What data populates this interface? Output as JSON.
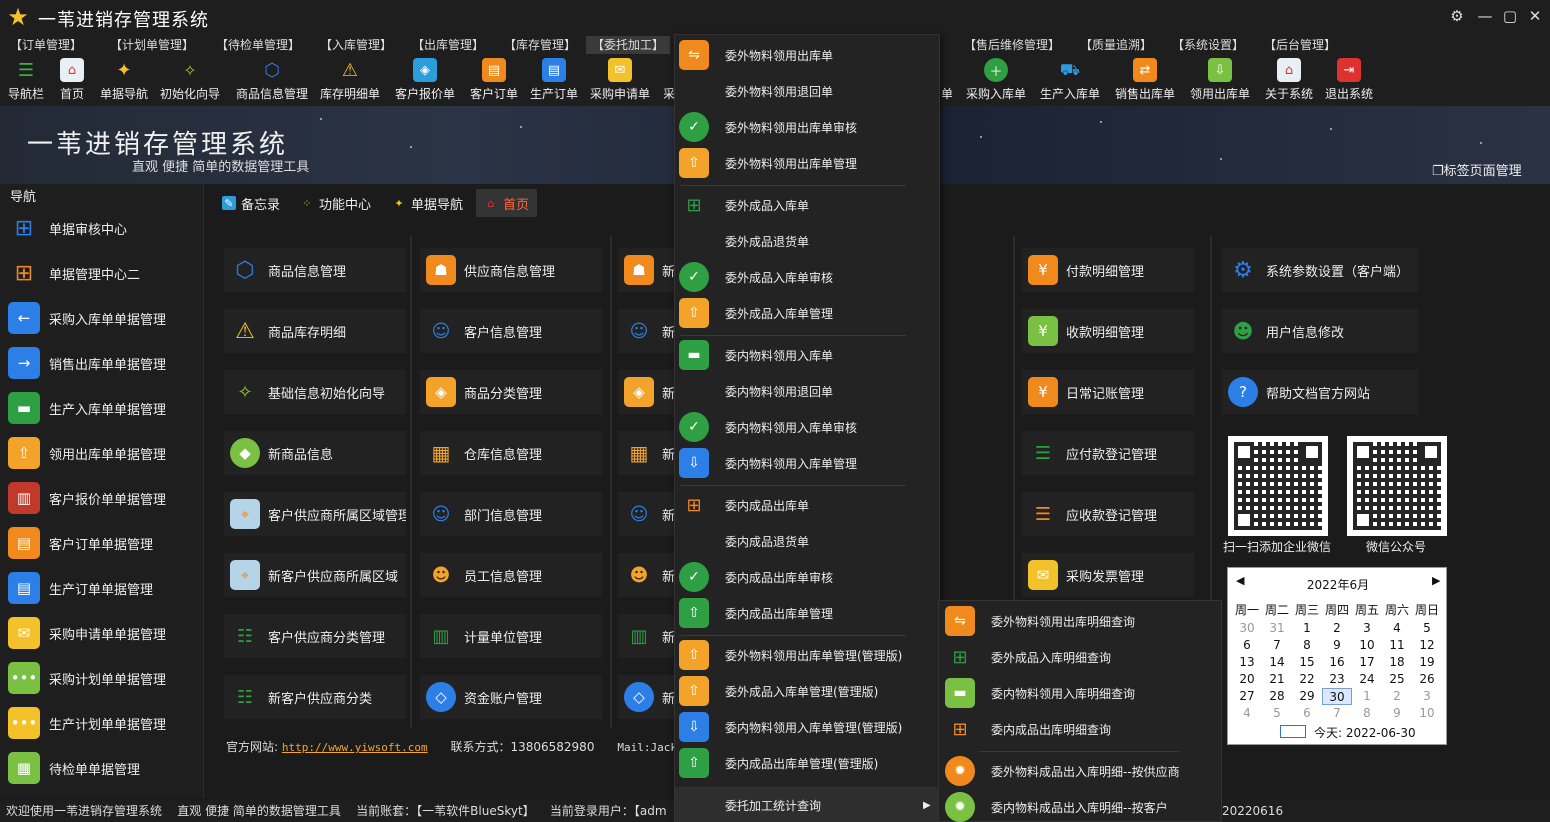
{
  "app": {
    "title": "一苇进销存管理系统"
  },
  "menus": [
    "【订单管理】",
    "【计划单管理】",
    "【待检单管理】",
    "【入库管理】",
    "【出库管理】",
    "【库存管理】",
    "【委托加工】",
    "【售后维修管理】",
    "【质量追溯】",
    "【系统设置】",
    "【后台管理】"
  ],
  "toolbar": [
    "导航栏",
    "首页",
    "单据导航",
    "初始化向导",
    "商品信息管理",
    "库存明细单",
    "客户报价单",
    "客户订单",
    "生产订单",
    "采购申请单",
    "采",
    "单",
    "采购入库单",
    "生产入库单",
    "销售出库单",
    "领用出库单",
    "关于系统",
    "退出系统"
  ],
  "banner": {
    "title": "一苇进销存管理系统",
    "subtitle": "直观 便捷 简单的数据管理工具",
    "tab_manage": "标签页面管理"
  },
  "sidebar": {
    "label": "导航",
    "items": [
      "单据审核中心",
      "单据管理中心二",
      "采购入库单单据管理",
      "销售出库单单据管理",
      "生产入库单单据管理",
      "领用出库单单据管理",
      "客户报价单单据管理",
      "客户订单单据管理",
      "生产订单单据管理",
      "采购申请单单据管理",
      "采购计划单单据管理",
      "生产计划单单据管理",
      "待检单单据管理"
    ]
  },
  "tabs": [
    "备忘录",
    "功能中心",
    "单据导航",
    "首页"
  ],
  "cards": {
    "col1": [
      "商品信息管理",
      "商品库存明细",
      "基础信息初始化向导",
      "新商品信息",
      "客户供应商所属区域管理",
      "新客户供应商所属区域",
      "客户供应商分类管理",
      "新客户供应商分类"
    ],
    "col2": [
      "供应商信息管理",
      "客户信息管理",
      "商品分类管理",
      "仓库信息管理",
      "部门信息管理",
      "员工信息管理",
      "计量单位管理",
      "资金账户管理"
    ],
    "col3": [
      "新",
      "新",
      "新",
      "新",
      "新",
      "新",
      "新",
      "新"
    ],
    "col4": [
      "付款明细管理",
      "收款明细管理",
      "日常记账管理",
      "应付款登记管理",
      "应收款登记管理",
      "采购发票管理"
    ],
    "col5": [
      "系统参数设置（客户端）",
      "用户信息修改",
      "帮助文档官方网站"
    ]
  },
  "qr": {
    "left_caption": "扫一扫添加企业微信",
    "right_caption": "微信公众号"
  },
  "calendar": {
    "month": "2022年6月",
    "weekdays": [
      "周一",
      "周二",
      "周三",
      "周四",
      "周五",
      "周六",
      "周日"
    ],
    "rows": [
      [
        "30",
        "31",
        "1",
        "2",
        "3",
        "4",
        "5"
      ],
      [
        "6",
        "7",
        "8",
        "9",
        "10",
        "11",
        "12"
      ],
      [
        "13",
        "14",
        "15",
        "16",
        "17",
        "18",
        "19"
      ],
      [
        "20",
        "21",
        "22",
        "23",
        "24",
        "25",
        "26"
      ],
      [
        "27",
        "28",
        "29",
        "30",
        "1",
        "2",
        "3"
      ],
      [
        "4",
        "5",
        "6",
        "7",
        "8",
        "9",
        "10"
      ]
    ],
    "today": "今天: 2022-06-30"
  },
  "footer": {
    "site_label": "官方网站:",
    "site_url": "http://www.yiwsoft.com",
    "contact": "联系方式：13806582980",
    "mail": "Mail:JackieL"
  },
  "status": {
    "text": "欢迎使用一苇进销存管理系统    直观 便捷 简单的数据管理工具    当前账套：【一苇软件BlueSkyt】    当前登录用户：【adm",
    "date_tail": "20220616"
  },
  "dropdown": [
    "委外物料领用出库单",
    "委外物料领用退回单",
    "委外物料领用出库单审核",
    "委外物料领用出库单管理",
    "委外成品入库单",
    "委外成品退货单",
    "委外成品入库单审核",
    "委外成品入库单管理",
    "委内物料领用入库单",
    "委内物料领用退回单",
    "委内物料领用入库单审核",
    "委内物料领用入库单管理",
    "委内成品出库单",
    "委内成品退货单",
    "委内成品出库单审核",
    "委内成品出库单管理",
    "委外物料领用出库单管理(管理版)",
    "委外成品入库单管理(管理版)",
    "委内物料领用入库单管理(管理版)",
    "委内成品出库单管理(管理版)",
    "委托加工统计查询"
  ],
  "submenu": [
    "委外物料领用出库明细查询",
    "委外成品入库明细查询",
    "委内物料领用入库明细查询",
    "委内成品出库明细查询",
    "委外物料成品出入库明细--按供应商",
    "委内物料成品出入库明细--按客户"
  ],
  "colors": {
    "orange": "#f08a1c",
    "blue": "#2d7fe8",
    "green": "#2ea043",
    "accent": "#ff6a3a"
  }
}
